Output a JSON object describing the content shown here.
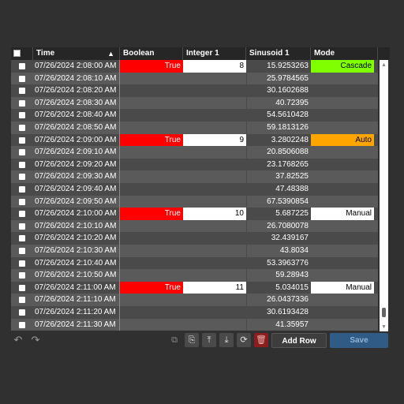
{
  "columns": {
    "time": "Time",
    "boolean": "Boolean",
    "integer": "Integer 1",
    "sinusoid": "Sinusoid 1",
    "mode": "Mode",
    "sort_indicator": "▲"
  },
  "colors": {
    "row_even": "#4a4a4a",
    "row_odd": "#5a5a5a",
    "true_bg": "#ff0000",
    "cascade_bg": "#80ff00",
    "auto_bg": "#ffa500",
    "manual_bg": "#ffffff"
  },
  "rows": [
    {
      "time": "07/26/2024 2:08:00 AM",
      "boolean": "True",
      "integer": "8",
      "sinusoid": "15.9253263",
      "mode": "Cascade"
    },
    {
      "time": "07/26/2024 2:08:10 AM",
      "boolean": "",
      "integer": "",
      "sinusoid": "25.9784565",
      "mode": ""
    },
    {
      "time": "07/26/2024 2:08:20 AM",
      "boolean": "",
      "integer": "",
      "sinusoid": "30.1602688",
      "mode": ""
    },
    {
      "time": "07/26/2024 2:08:30 AM",
      "boolean": "",
      "integer": "",
      "sinusoid": "40.72395",
      "mode": ""
    },
    {
      "time": "07/26/2024 2:08:40 AM",
      "boolean": "",
      "integer": "",
      "sinusoid": "54.5610428",
      "mode": ""
    },
    {
      "time": "07/26/2024 2:08:50 AM",
      "boolean": "",
      "integer": "",
      "sinusoid": "59.1813126",
      "mode": ""
    },
    {
      "time": "07/26/2024 2:09:00 AM",
      "boolean": "True",
      "integer": "9",
      "sinusoid": "3.2802248",
      "mode": "Auto"
    },
    {
      "time": "07/26/2024 2:09:10 AM",
      "boolean": "",
      "integer": "",
      "sinusoid": "20.8506088",
      "mode": ""
    },
    {
      "time": "07/26/2024 2:09:20 AM",
      "boolean": "",
      "integer": "",
      "sinusoid": "23.1768265",
      "mode": ""
    },
    {
      "time": "07/26/2024 2:09:30 AM",
      "boolean": "",
      "integer": "",
      "sinusoid": "37.82525",
      "mode": ""
    },
    {
      "time": "07/26/2024 2:09:40 AM",
      "boolean": "",
      "integer": "",
      "sinusoid": "47.48388",
      "mode": ""
    },
    {
      "time": "07/26/2024 2:09:50 AM",
      "boolean": "",
      "integer": "",
      "sinusoid": "67.5390854",
      "mode": ""
    },
    {
      "time": "07/26/2024 2:10:00 AM",
      "boolean": "True",
      "integer": "10",
      "sinusoid": "5.687225",
      "mode": "Manual"
    },
    {
      "time": "07/26/2024 2:10:10 AM",
      "boolean": "",
      "integer": "",
      "sinusoid": "26.7080078",
      "mode": ""
    },
    {
      "time": "07/26/2024 2:10:20 AM",
      "boolean": "",
      "integer": "",
      "sinusoid": "32.439167",
      "mode": ""
    },
    {
      "time": "07/26/2024 2:10:30 AM",
      "boolean": "",
      "integer": "",
      "sinusoid": "43.8034",
      "mode": ""
    },
    {
      "time": "07/26/2024 2:10:40 AM",
      "boolean": "",
      "integer": "",
      "sinusoid": "53.3963776",
      "mode": ""
    },
    {
      "time": "07/26/2024 2:10:50 AM",
      "boolean": "",
      "integer": "",
      "sinusoid": "59.28943",
      "mode": ""
    },
    {
      "time": "07/26/2024 2:11:00 AM",
      "boolean": "True",
      "integer": "11",
      "sinusoid": "5.034015",
      "mode": "Manual"
    },
    {
      "time": "07/26/2024 2:11:10 AM",
      "boolean": "",
      "integer": "",
      "sinusoid": "26.0437336",
      "mode": ""
    },
    {
      "time": "07/26/2024 2:11:20 AM",
      "boolean": "",
      "integer": "",
      "sinusoid": "30.6193428",
      "mode": ""
    },
    {
      "time": "07/26/2024 2:11:30 AM",
      "boolean": "",
      "integer": "",
      "sinusoid": "41.35957",
      "mode": ""
    }
  ],
  "toolbar": {
    "undo_icon": "↶",
    "redo_icon": "↷",
    "duplicate_icon": "⧉",
    "copy_icon": "⎘",
    "upload_icon": "⤒",
    "download_icon": "⤓",
    "refresh_icon": "⟳",
    "delete_icon": "🗑",
    "add_row_label": "Add Row",
    "save_label": "Save"
  }
}
